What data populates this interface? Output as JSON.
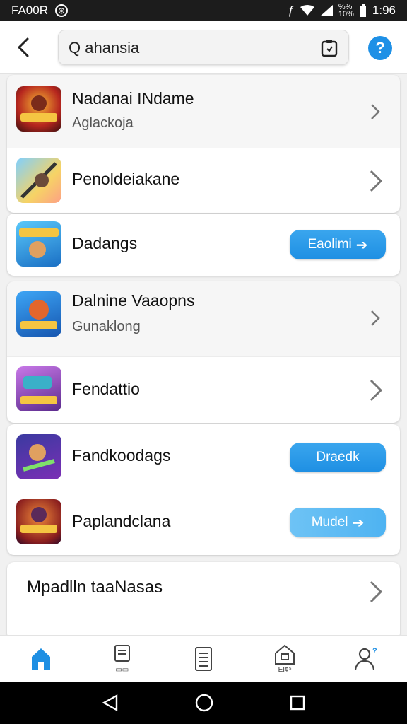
{
  "status_bar": {
    "carrier": "FA00R",
    "signal_small": "%%",
    "signal_small2": "10%",
    "time": "1:96"
  },
  "top_bar": {
    "search_value": "Q ahansia",
    "help_label": "?"
  },
  "items": [
    {
      "title": "Nadanai INdame",
      "subtitle": "Aglackoja"
    },
    {
      "title": "Penoldeiakane"
    },
    {
      "title": "Dadangs",
      "button": "Eaolimi"
    },
    {
      "title": "Dalnine Vaaopns",
      "subtitle": "Gunaklong"
    },
    {
      "title": "Fendattio"
    },
    {
      "title": "Fandkoodags",
      "button": "Draedk"
    },
    {
      "title": "Paplandclana",
      "button": "Mudel"
    }
  ],
  "more": {
    "title": "Mpadlln taaNasas"
  },
  "bottom_nav": {
    "tab2_label": "▭▭",
    "tab4_label": "EI¢⁵"
  },
  "colors": {
    "accent": "#1e90e6",
    "button_light": "#5cbaf3"
  }
}
